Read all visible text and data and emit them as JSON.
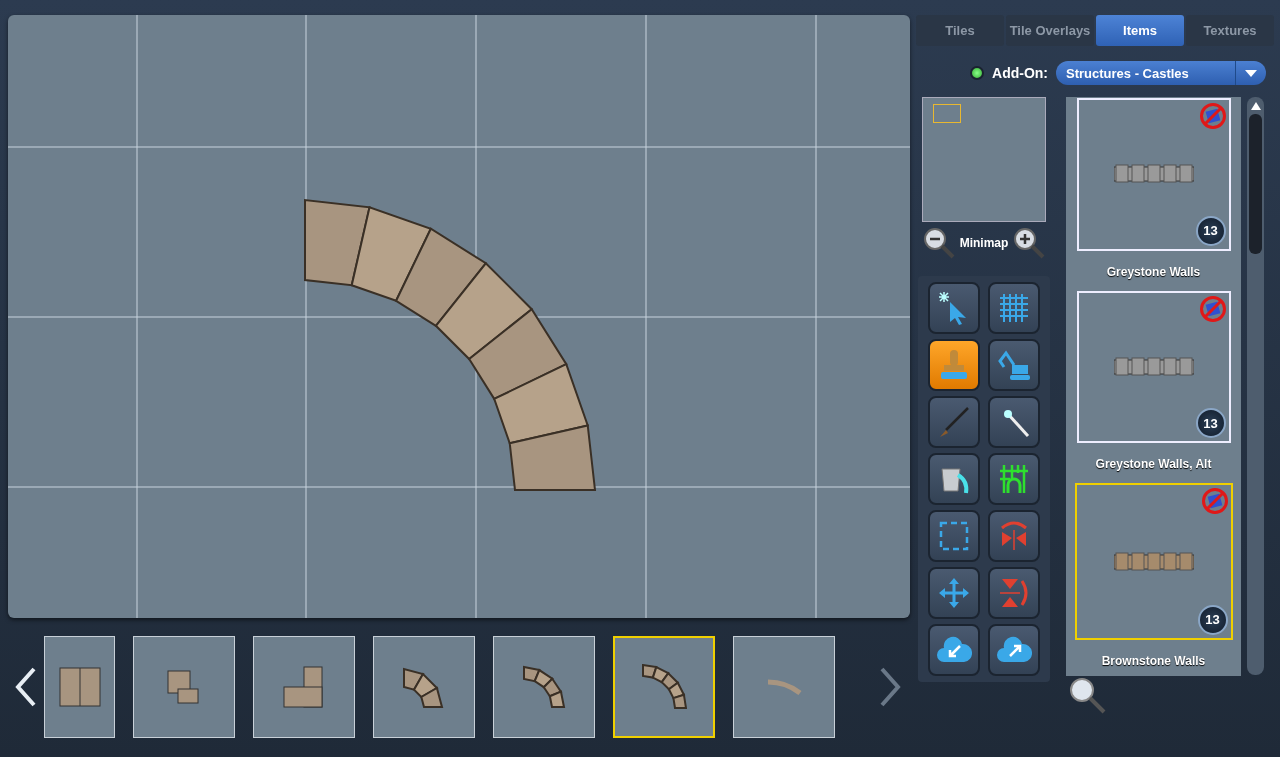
{
  "tabs": [
    {
      "label": "Tiles",
      "selected": false
    },
    {
      "label": "Tile Overlays",
      "selected": false
    },
    {
      "label": "Items",
      "selected": true
    },
    {
      "label": "Textures",
      "selected": false
    }
  ],
  "add_on": {
    "label": "Add-On:",
    "value": "Structures - Castles"
  },
  "minimap": {
    "label": "Minimap"
  },
  "tools": [
    {
      "selected": false
    },
    {
      "selected": false
    },
    {
      "selected": true
    },
    {
      "selected": false
    },
    {
      "selected": false
    },
    {
      "selected": false
    },
    {
      "selected": false
    },
    {
      "selected": false
    },
    {
      "selected": false
    },
    {
      "selected": false
    },
    {
      "selected": false
    },
    {
      "selected": false
    },
    {
      "selected": false
    },
    {
      "selected": false
    }
  ],
  "items": [
    {
      "name": "Greystone Walls",
      "count": "13",
      "selected": false,
      "color": "#9a9a9a"
    },
    {
      "name": "Greystone Walls, Alt",
      "count": "13",
      "selected": false,
      "color": "#9a9a9a"
    },
    {
      "name": "Brownstone Walls",
      "count": "13",
      "selected": true,
      "color": "#a68b6c"
    }
  ],
  "thumbnails": [
    {
      "selected": false
    },
    {
      "selected": false
    },
    {
      "selected": false
    },
    {
      "selected": false
    },
    {
      "selected": false
    },
    {
      "selected": true
    },
    {
      "selected": false
    }
  ]
}
